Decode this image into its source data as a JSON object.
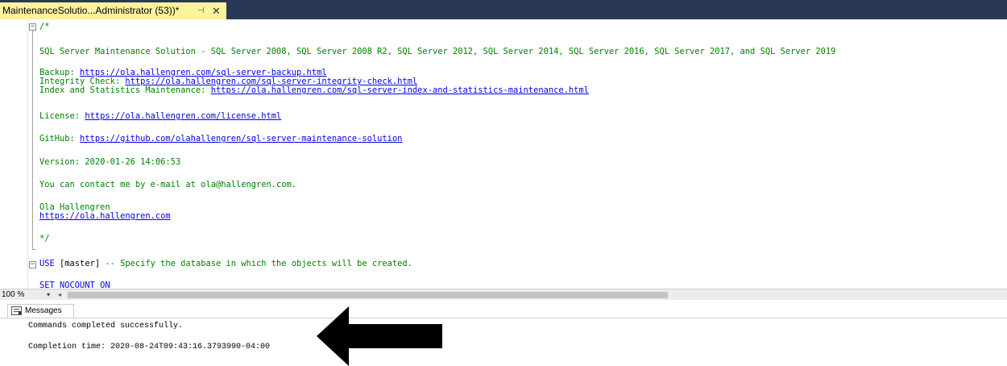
{
  "tab": {
    "title": "MaintenanceSolutio...Administrator (53))*",
    "pin_glyph": "⊣",
    "close_glyph": "✕"
  },
  "editor": {
    "comment_open": "/*",
    "title_line": "SQL Server Maintenance Solution - SQL Server 2008, SQL Server 2008 R2, SQL Server 2012, SQL Server 2014, SQL Server 2016, SQL Server 2017, and SQL Server 2019",
    "backup_label": "Backup: ",
    "backup_url": "https://ola.hallengren.com/sql-server-backup.html",
    "integrity_label": "Integrity Check: ",
    "integrity_url": "https://ola.hallengren.com/sql-server-integrity-check.html",
    "index_label": "Index and Statistics Maintenance: ",
    "index_url": "https://ola.hallengren.com/sql-server-index-and-statistics-maintenance.html",
    "license_label": "License: ",
    "license_url": "https://ola.hallengren.com/license.html",
    "github_label": "GitHub: ",
    "github_url": "https://github.com/olahallengren/sql-server-maintenance-solution",
    "version_line": "Version: 2020-01-26 14:06:53",
    "contact_line": "You can contact me by e-mail at ola@hallengren.com.",
    "author_name": "Ola Hallengren",
    "author_url": "https://ola.hallengren.com",
    "comment_close": "*/",
    "use_keyword": "USE",
    "use_target": " [master] ",
    "use_comment": "-- Specify the database in which the objects will be created.",
    "set_line": "SET NOCOUNT ON"
  },
  "status": {
    "zoom": "100 %",
    "zoom_arrow": "▾",
    "scroll_left": "◂"
  },
  "messages": {
    "tab_label": "Messages",
    "line1": "Commands completed successfully.",
    "line2": "Completion time: 2020-08-24T09:43:16.3793990-04:00"
  }
}
